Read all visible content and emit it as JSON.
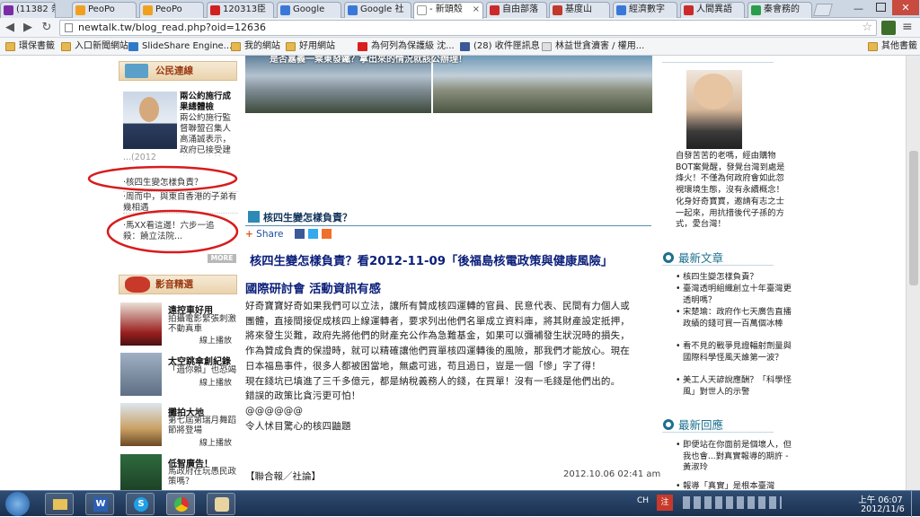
{
  "browser": {
    "tabs": [
      {
        "label": "(11382 条",
        "color": "#7a2ca6"
      },
      {
        "label": "PeoPo",
        "color": "#f0a020"
      },
      {
        "label": "PeoPo",
        "color": "#f0a020"
      },
      {
        "label": "120313臣",
        "color": "#d02020"
      },
      {
        "label": "Google",
        "color": "#3a78d8"
      },
      {
        "label": "Google 社",
        "color": "#3a78d8"
      },
      {
        "label": "- 新頭殼",
        "color": "#ffffff"
      },
      {
        "label": "自由部落",
        "color": "#cc2a2a"
      },
      {
        "label": "基度山",
        "color": "#c0392b"
      },
      {
        "label": "經濟數字",
        "color": "#3a78d8"
      },
      {
        "label": "人間異語",
        "color": "#cc2a2a"
      },
      {
        "label": "秦會務的",
        "color": "#2a9d4a"
      }
    ],
    "url": "newtalk.tw/blog_read.php?oid=12636",
    "bookmarks": [
      {
        "label": "環保書籤",
        "icon": "folder-icon"
      },
      {
        "label": "入口新聞網站",
        "icon": "folder-icon"
      },
      {
        "label": "SlideShare Engine...",
        "icon": "slideshare-icon"
      },
      {
        "label": "我的網站",
        "icon": "folder-icon"
      },
      {
        "label": "好用網站",
        "icon": "folder-icon"
      },
      {
        "label": "為何列為保護級 沈...",
        "icon": "youtube-icon"
      },
      {
        "label": "(28) 收件匣訊息",
        "icon": "facebook-icon"
      },
      {
        "label": "林益世貪瀆害 / 權用...",
        "icon": "doc-icon"
      },
      {
        "label": "其他書籤",
        "icon": "folder-icon"
      }
    ]
  },
  "page": {
    "left": {
      "civic_title": "公民連線",
      "feature_title": "兩公約施行成果總體檢",
      "feature_desc": "兩公約施行監督聯盟召集人高涌誠表示，政府已接受建議，同意按照兩公約精神，將國家報告準",
      "feature_more": "...(2012",
      "links": [
        "核四生變怎樣負責？",
        "周而中，與東自香港的子弟有幾相遇",
        "馬XX看這邊！六步一追殺：饒立法院..."
      ],
      "more_label": "MORE",
      "video_title": "影音精選",
      "videos": [
        {
          "title": "遠控車好用",
          "desc": "拍攝電影緊張刺激不動真車",
          "link": "線上播放"
        },
        {
          "title": "太空跳傘創紀錄",
          "desc": "「過你賴」也恐竭",
          "link": "線上播放"
        },
        {
          "title": "攤拍大地",
          "desc": "第七屆第瑞月舞蹈節將登場",
          "link": "線上播放"
        },
        {
          "title": "低智廣告！",
          "desc": "馬政府在玩愚民政策嗎？",
          "link": ""
        }
      ]
    },
    "banner_caption": "是否嘉義一乘東發鐵？拿出來的情況就該公辦理！",
    "article": {
      "category": "核四生變怎樣負責？",
      "share_label": "Share",
      "title_line1": "核四生變怎樣負責？看2012-11-09「後福島核電政策與健康風險」",
      "title_line2": "國際研討會 活動資訊有感",
      "paragraph1": [
        "好奇寶寶好奇如果我們可以立法，讓所有贊成核四運轉的官員、民意代表、民間有力個人或",
        "團體，直接間接促成核四上線運轉者，要求列出他們名單成立資料庫，將其財產設定抵押，",
        "將來發生災難，政府先將他們的財產充公作為急難基金，如果可以彌補發生狀況時的損失，",
        "作為贊成負責的保證時，就可以精確讓他們買單核四運轉後的風險，那我們才能放心。現在",
        "日本福島事件，很多人都被困當地，無處可逃，苟且過日，豈是一個「慘」字了得！",
        "現在錢坑已填進了三千多億元，都是納稅義務人的錢，在買單！沒有一毛錢是他們出的。",
        "錯誤的政策比貪污更可怕！"
      ],
      "at_line": "@@@@@@",
      "closing": "令人怵目驚心的核四鼬題",
      "source": "【聯合報／社論】",
      "datetime": "2012.10.06 02:41 am"
    },
    "right": {
      "profile_text": "自發苦苦的老嗎，經由購物BOT案覺醒，發覺台灣到處是烽火！不僅為何政府會如此忽視環境生態，沒有永續概念！化身好奇寶寶，邀請有志之士一起來，用抗措後代子孫的方式，愛台灣！",
      "latest_articles_title": "最新文章",
      "latest_articles": [
        "核四生變怎樣負責？",
        "臺灣透明組織創立十年臺灣更透明嗎？",
        "宋楚瑜：政府作七天廣告直播政績的錢可買一百萬個冰棒",
        "看不見的戰爭見證輻射劑量與國際科學怪風天誰第一波？",
        "美工人天諺說應酬？「科學怪風」對世人的示警"
      ],
      "latest_replies_title": "最新回應",
      "latest_replies": [
        "即便站在你面前是個壞人，但我也會...對真實報導的期許 - 黃淑玲",
        "報導「真實」是根本臺灣"
      ]
    }
  },
  "taskbar": {
    "lang": "CH",
    "time": "上午 06:07",
    "date": "2012/11/6"
  },
  "colors": {
    "accent_blue": "#0b1f7a",
    "section_brown": "#9b3a12",
    "annotation_red": "#d81b1b",
    "ring_teal": "#1c6f8e"
  }
}
